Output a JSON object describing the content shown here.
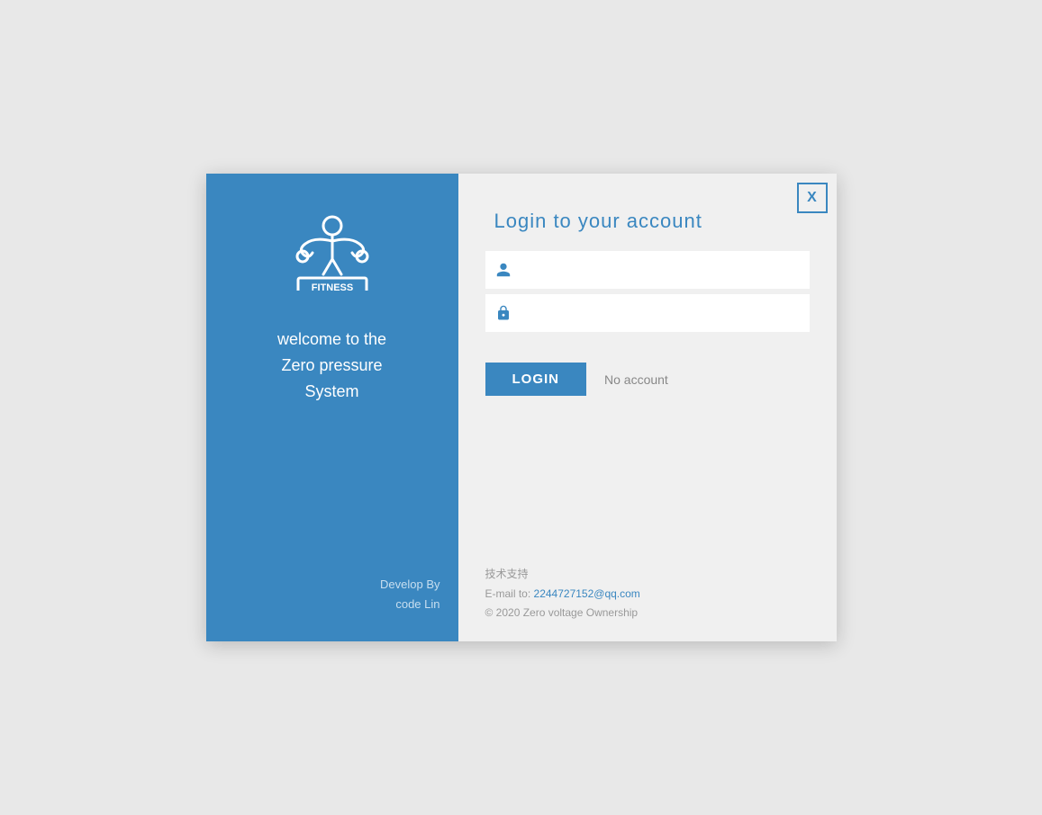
{
  "left_panel": {
    "welcome_line1": "welcome to the",
    "welcome_line2": "Zero pressure",
    "welcome_line3": "System",
    "dev_label": "Develop By",
    "dev_author": "code Lin"
  },
  "right_panel": {
    "close_label": "X",
    "login_title": "Login to your account",
    "username_placeholder": "",
    "password_placeholder": "",
    "login_button": "LOGIN",
    "no_account_label": "No account"
  },
  "footer": {
    "tech_support": "技术支持",
    "email_label": "E-mail to:",
    "email": "2244727152@qq.com",
    "copyright": "© 2020  Zero voltage Ownership"
  },
  "icons": {
    "user": "👤",
    "lock": "🔒"
  }
}
